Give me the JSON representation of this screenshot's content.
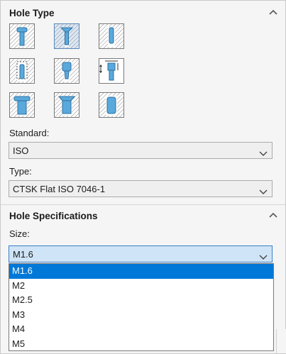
{
  "hole_type": {
    "title": "Hole Type",
    "buttons": [
      {
        "name": "hole-type-counterbore-icon",
        "selected": false
      },
      {
        "name": "hole-type-countersink-icon",
        "selected": true
      },
      {
        "name": "hole-type-simple-hole-icon",
        "selected": false
      },
      {
        "name": "hole-type-tapped-hole-icon",
        "selected": false
      },
      {
        "name": "hole-type-tapered-hole-icon",
        "selected": false
      },
      {
        "name": "hole-type-legacy-hole-icon",
        "selected": false
      },
      {
        "name": "hole-type-counterbore-slot-icon",
        "selected": false
      },
      {
        "name": "hole-type-countersink-slot-icon",
        "selected": false
      },
      {
        "name": "hole-type-slot-icon",
        "selected": false
      }
    ],
    "standard_label": "Standard:",
    "standard_value": "ISO",
    "type_label": "Type:",
    "type_value": "CTSK Flat ISO 7046-1"
  },
  "hole_specifications": {
    "title": "Hole Specifications",
    "size_label": "Size:",
    "size_value": "M1.6",
    "size_options": [
      "M1.6",
      "M2",
      "M2.5",
      "M3",
      "M4",
      "M5"
    ],
    "selected_index": 0
  },
  "colors": {
    "accent": "#0078d7",
    "selected_field": "#cfe4f7",
    "part_blue": "#5aa9dc"
  }
}
